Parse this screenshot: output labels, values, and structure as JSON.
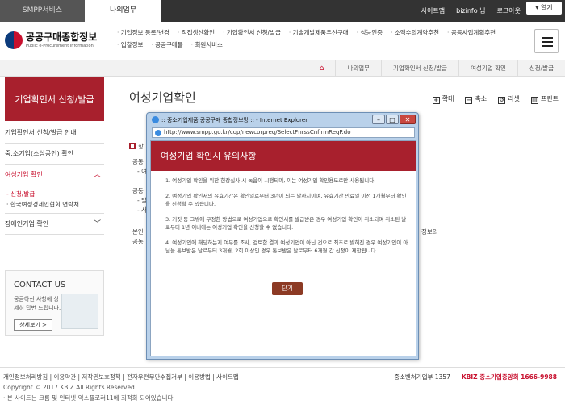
{
  "top": {
    "tab_service": "SMPP서비스",
    "tab_mywork": "나의업무",
    "sitemap": "사이트맵",
    "user": "bizinfo 님",
    "logout": "로그아웃",
    "open": "열기"
  },
  "logo": {
    "title": "공공구매종합정보",
    "subtitle": "Public e-Procurement Information"
  },
  "gnb": {
    "row1": [
      "기업정보 등록/변경",
      "직접생산확인",
      "기업확인서 신청/발급",
      "기술개발제품우선구매",
      "성능인증",
      "소액수의계약추천",
      "공공사업계획추천"
    ],
    "row2": [
      "입찰정보",
      "공공구매몰",
      "회원서비스"
    ]
  },
  "breadcrumb": [
    "나의업무",
    "기업확인서 신청/발급",
    "여성기업 확인",
    "신청/발급"
  ],
  "lnb": {
    "title": "기업확인서 신청/발급",
    "items": [
      "기업확인서 신청/발급 안내",
      "중.소기업(소상공인) 확인",
      "여성기업 확인",
      "장애인기업 확인"
    ],
    "subs": [
      "신청/발급",
      "한국여성경제인협회 연락처"
    ]
  },
  "contact": {
    "title": "CONTACT US",
    "text": "궁금하신 사항에 상세히 답변 드립니다.",
    "button": "상세보기 >"
  },
  "page": {
    "title": "여성기업확인",
    "tools": [
      "확대",
      "축소",
      "리셋",
      "프린트"
    ]
  },
  "bg": {
    "h": "항",
    "l1": "공동",
    "l2": "- 여성",
    "l3": "공동",
    "l4": "- 발급",
    "l5": "- 사업",
    "l6": "본인",
    "l7": "공동",
    "r1": "정보의"
  },
  "footer": {
    "links": "개인정보처리방침 | 이용약관 | 저작권보호정책 | 전자우편무단수집거부 | 이용방법 | 사이트맵",
    "copy": "Copyright © 2017 KBIZ All Rights Reserved.",
    "note": "· 본 사이트는 크롬 및 인터넷 익스플로러11에 최적화 되어있습니다.",
    "sme": "중소벤처기업부 1357",
    "kbiz": "KBIZ 중소기업중앙회 1666-9988"
  },
  "popup": {
    "window_title": ":: 중소기업제품 공공구매 종합정보망 :: - Internet Explorer",
    "url": "http://www.smpp.go.kr/cop/newcorpreq/SelectFnrssCnfirmReqP.do",
    "heading": "여성기업 확인시 유의사항",
    "notes": [
      "1. 여성기업 확인을 위한 현장실사 시 녹음이 시행되며, 이는 여성기업 확인용도로만 사용됩니다.",
      "2. 여성기업 확인서의 유효기간은 확인일로부터 3년이 되는 날까지이며, 유효기간 만료일 이전 1개월부터 확인을 신청할 수 있습니다.",
      "3. 거짓 등 그밖에 부정한 방법으로 여성기업으로 확인서를 발급받은 경우 여성기업 확인이 취소되며 취소된 날로부터 1년 이내에는 여성기업 확인을 신청할 수 없습니다.",
      "4. 여성기업에 해당하는지 여부를 조사, 검토한 결과 여성기업이 아닌 것으로 최초로 밝혀진 경우 여성기업이 아님을 통보받은 날로부터 3개월, 2회 이상인 경우 통보받은 날로부터 6개월 간 신청이 제한됩니다."
    ],
    "close": "닫기"
  }
}
